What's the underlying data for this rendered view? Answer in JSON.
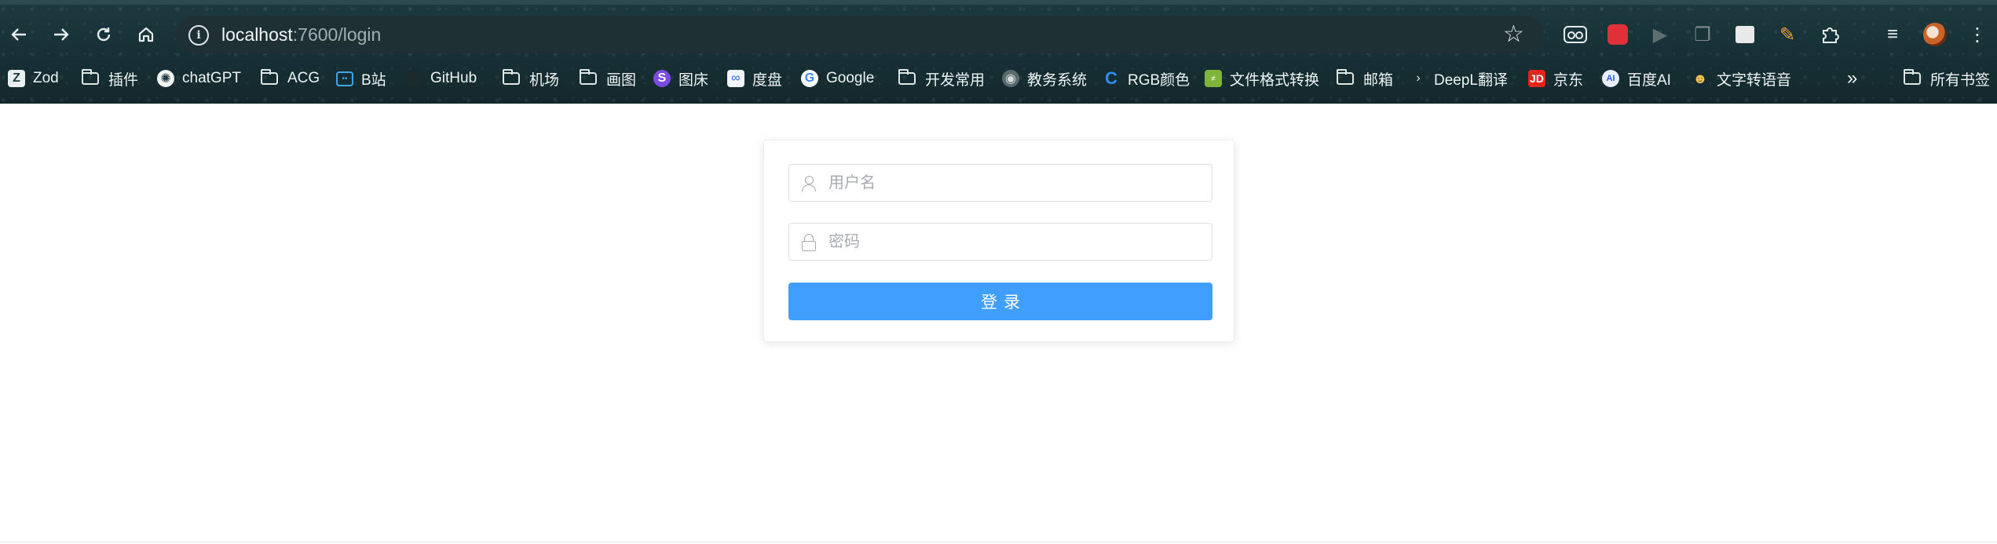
{
  "browser": {
    "url_host": "localhost",
    "url_path": ":7600/login",
    "icons": {
      "back": "arrow-left-icon",
      "forward": "arrow-right-icon",
      "reload": "reload-icon",
      "home": "home-icon",
      "site_info": "info-icon",
      "bookmark_star": "star-icon"
    },
    "extensions": [
      "glasses-ext-icon",
      "red-ext-icon",
      "play-ext-icon",
      "copy-ext-icon",
      "image-ext-icon",
      "pen-ext-icon",
      "puzzle-icon",
      "queue-icon",
      "profile-avatar",
      "kebab-menu-icon"
    ]
  },
  "bookmarks": {
    "items": [
      {
        "label": "Zod",
        "icon": "zod-icon"
      },
      {
        "label": "插件",
        "icon": "folder-icon"
      },
      {
        "label": "chatGPT",
        "icon": "openai-icon"
      },
      {
        "label": "ACG",
        "icon": "folder-icon"
      },
      {
        "label": "B站",
        "icon": "bilibili-icon"
      },
      {
        "label": "GitHub",
        "icon": "github-icon"
      },
      {
        "label": "机场",
        "icon": "folder-icon"
      },
      {
        "label": "画图",
        "icon": "folder-icon"
      },
      {
        "label": "图床",
        "icon": "s-icon"
      },
      {
        "label": "度盘",
        "icon": "baidupan-icon"
      },
      {
        "label": "Google",
        "icon": "google-icon"
      },
      {
        "label": "开发常用",
        "icon": "folder-icon"
      },
      {
        "label": "教务系统",
        "icon": "globe-icon"
      },
      {
        "label": "RGB颜色",
        "icon": "c-icon"
      },
      {
        "label": "文件格式转换",
        "icon": "convert-icon"
      },
      {
        "label": "邮箱",
        "icon": "folder-icon"
      },
      {
        "label": "DeepL翻译",
        "icon": "deepl-icon"
      },
      {
        "label": "京东",
        "icon": "jd-icon"
      },
      {
        "label": "百度AI",
        "icon": "baiduai-icon"
      },
      {
        "label": "文字转语音",
        "icon": "tts-icon"
      }
    ],
    "overflow_icon": "chevron-double-right-icon",
    "all_bookmarks": "所有书签"
  },
  "login": {
    "username_placeholder": "用户名",
    "password_placeholder": "密码",
    "submit_label": "登录",
    "accent_color": "#409eff"
  }
}
